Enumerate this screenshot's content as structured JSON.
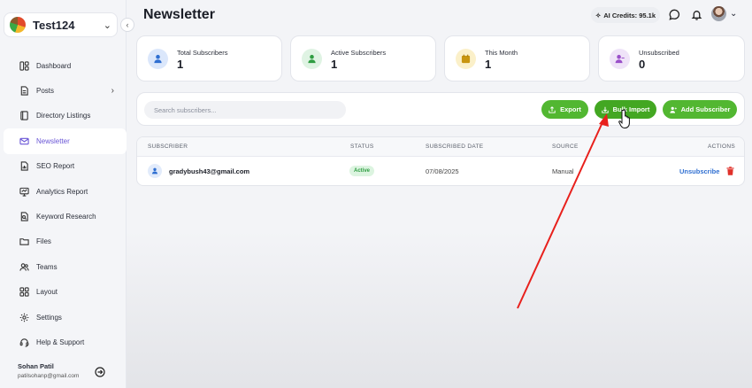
{
  "sidebar": {
    "project_name": "Test124",
    "items": [
      {
        "label": "Dashboard",
        "icon": "dashboard-icon"
      },
      {
        "label": "Posts",
        "icon": "document-icon"
      },
      {
        "label": "Directory Listings",
        "icon": "book-icon"
      },
      {
        "label": "Newsletter",
        "icon": "mail-icon"
      },
      {
        "label": "SEO Report",
        "icon": "file-chart-icon"
      },
      {
        "label": "Analytics Report",
        "icon": "monitor-icon"
      },
      {
        "label": "Keyword Research",
        "icon": "file-search-icon"
      },
      {
        "label": "Files",
        "icon": "folder-icon"
      },
      {
        "label": "Teams",
        "icon": "users-icon"
      },
      {
        "label": "Layout",
        "icon": "grid-icon"
      },
      {
        "label": "Settings",
        "icon": "gear-icon"
      },
      {
        "label": "Help & Support",
        "icon": "headset-icon"
      }
    ],
    "active": "Newsletter",
    "user": {
      "name": "Sohan Patil",
      "email": "patilsohanp@gmail.com"
    }
  },
  "header": {
    "title": "Newsletter",
    "credits": "AI Credits: 95.1k"
  },
  "stats": [
    {
      "label": "Total Subscribers",
      "value": "1",
      "icon": "user-icon",
      "color": "#dbe7fb"
    },
    {
      "label": "Active Subscribers",
      "value": "1",
      "icon": "user-check-icon",
      "color": "#dff3e3"
    },
    {
      "label": "This Month",
      "value": "1",
      "icon": "calendar-icon",
      "color": "#fbf0c9"
    },
    {
      "label": "Unsubscribed",
      "value": "0",
      "icon": "user-minus-icon",
      "color": "#efe3f8"
    }
  ],
  "toolbar": {
    "search_placeholder": "Search subscribers...",
    "export_label": "Export",
    "bulk_import_label": "Bulk Import",
    "add_subscriber_label": "Add Subscriber"
  },
  "table": {
    "columns": [
      "SUBSCRIBER",
      "STATUS",
      "SUBSCRIBED DATE",
      "SOURCE",
      "ACTIONS"
    ],
    "rows": [
      {
        "email": "gradybush43@gmail.com",
        "status": "Active",
        "date": "07/08/2025",
        "source": "Manual",
        "action": "Unsubscribe"
      }
    ]
  },
  "colors": {
    "accent": "#6a56d6",
    "primary_button": "#52b731",
    "annotation_arrow": "#e8201c"
  }
}
